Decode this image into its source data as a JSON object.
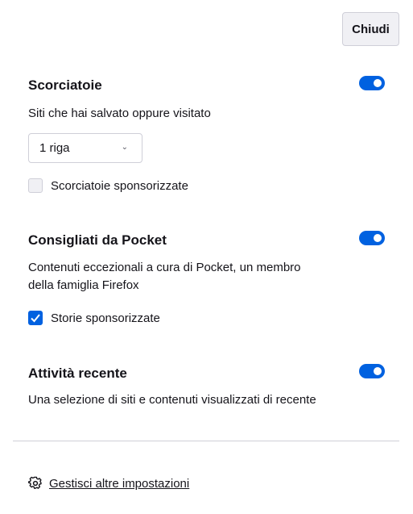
{
  "close_label": "Chiudi",
  "shortcuts": {
    "title": "Scorciatoie",
    "description": "Siti che hai salvato oppure visitato",
    "rows_selected": "1 riga",
    "sponsored_label": "Scorciatoie sponsorizzate",
    "enabled": true,
    "sponsored_checked": false
  },
  "pocket": {
    "title": "Consigliati da Pocket",
    "description_line1": "Contenuti eccezionali a cura di Pocket, un membro",
    "description_line2": "della famiglia Firefox",
    "sponsored_label": "Storie sponsorizzate",
    "enabled": true,
    "sponsored_checked": true
  },
  "recent": {
    "title": "Attività recente",
    "description": "Una selezione di siti e contenuti visualizzati di recente",
    "enabled": true
  },
  "manage_label": "Gestisci altre impostazioni",
  "colors": {
    "accent": "#0061e0",
    "text": "#15141a",
    "border": "#cfcfd8"
  }
}
